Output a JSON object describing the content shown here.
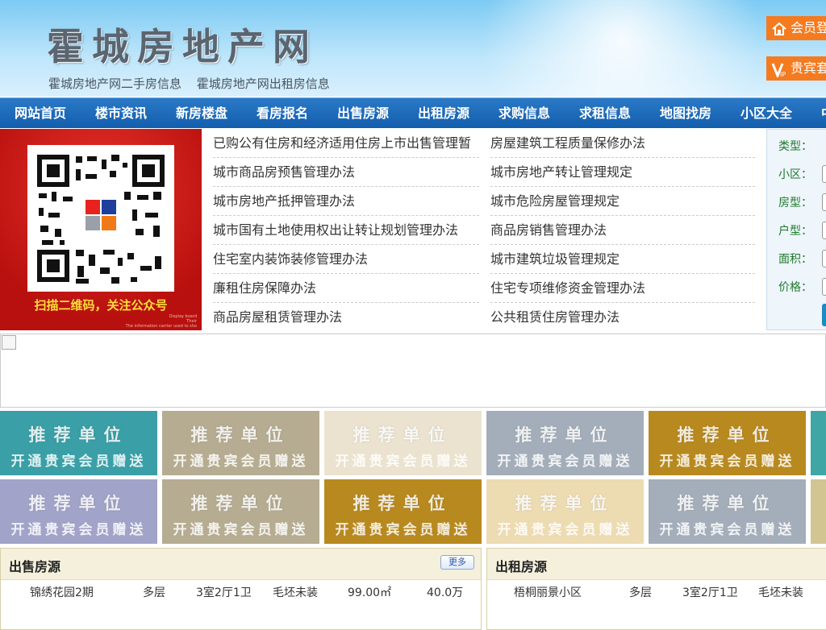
{
  "header": {
    "site_title": "霍城房地产网",
    "sub_links": [
      "霍城房地产网二手房信息",
      "霍城房地产网出租房信息"
    ],
    "member_login": "会员登",
    "vip_label": "贵宾套"
  },
  "nav": [
    "网站首页",
    "楼市资讯",
    "新房楼盘",
    "看房报名",
    "出售房源",
    "出租房源",
    "求购信息",
    "求租信息",
    "地图找房",
    "小区大全",
    "中"
  ],
  "qr": {
    "caption": "扫描二维码，关注公众号",
    "tiny_text": [
      "Display board",
      "Their",
      "The information carrier used to sho"
    ]
  },
  "laws": {
    "left": [
      "已购公有住房和经济适用住房上市出售管理暂",
      "城市商品房预售管理办法",
      "城市房地产抵押管理办法",
      "城市国有土地使用权出让转让规划管理办法",
      "住宅室内装饰装修管理办法",
      "廉租住房保障办法",
      "商品房屋租赁管理办法"
    ],
    "right": [
      "房屋建筑工程质量保修办法",
      "城市房地产转让管理规定",
      "城市危险房屋管理规定",
      "商品房销售管理办法",
      "城市建筑垃圾管理规定",
      "住宅专项维修资金管理办法",
      "公共租赁住房管理办法"
    ]
  },
  "search": {
    "labels": [
      "类型：",
      "小区：",
      "房型：",
      "户型：",
      "面积：",
      "价格："
    ]
  },
  "promo": {
    "line1": "推荐单位",
    "line2": "开通贵宾会员赠送",
    "colors_row1": [
      "#3a9fa6",
      "#b6ac91",
      "#ebe3cf",
      "#a4aeba",
      "#b8891f",
      "#3fa5a5"
    ],
    "colors_row2": [
      "#a1a3c8",
      "#b6ac91",
      "#b8891f",
      "#eddbb2",
      "#a4aeba",
      "#d3c592"
    ]
  },
  "sale_panel": {
    "title": "出售房源",
    "more": "更多",
    "rows": [
      [
        "锦绣花园2期",
        "多层",
        "3室2厅1卫",
        "毛坯未装",
        "99.00㎡",
        "40.0万"
      ],
      [
        "",
        "",
        "",
        "",
        "",
        ""
      ]
    ]
  },
  "rent_panel": {
    "title": "出租房源",
    "rows": [
      [
        "梧桐丽景小区",
        "多层",
        "3室2厅1卫",
        "毛坯未装"
      ],
      [
        "",
        "",
        "",
        ""
      ]
    ]
  }
}
